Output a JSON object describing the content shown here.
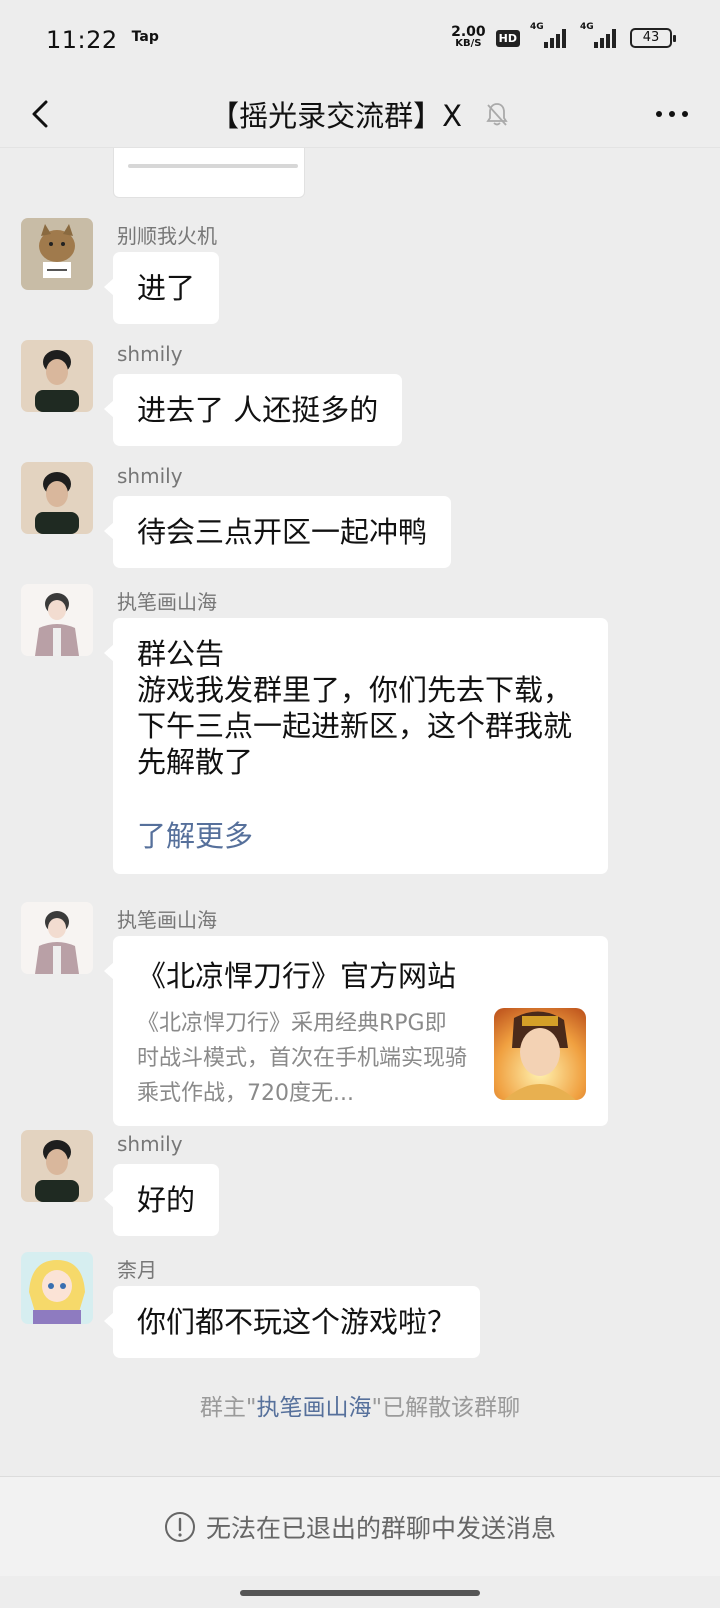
{
  "status_bar": {
    "time": "11:22",
    "app_tag": "Tap",
    "net_speed": "2.00",
    "net_unit": "KB/S",
    "hd_badge": "HD",
    "signal1_label": "4G",
    "signal2_label": "4G",
    "battery": "43"
  },
  "header": {
    "title": "【摇光录交流群】X",
    "back_icon": "chevron-left-icon",
    "mute_icon": "bell-muted-icon",
    "more_icon": "more-dots-icon"
  },
  "messages": [
    {
      "sender": "别顺我火机",
      "text": "进了",
      "avatar": "cat-photo"
    },
    {
      "sender": "shmily",
      "text": "进去了 人还挺多的",
      "avatar": "man-photo"
    },
    {
      "sender": "shmily",
      "text": "待会三点开区一起冲鸭",
      "avatar": "man-photo"
    },
    {
      "sender": "执笔画山海",
      "avatar": "illustrated-man",
      "notice_title": "群公告",
      "notice_body": "游戏我发群里了，你们先去下载，下午三点一起进新区，这个群我就先解散了",
      "notice_more": "了解更多"
    },
    {
      "sender": "执笔画山海",
      "avatar": "illustrated-man",
      "link_title": "《北凉悍刀行》官方网站",
      "link_desc": "《北凉悍刀行》采用经典RPG即时战斗模式，首次在手机端实现骑乘式作战，720度无..."
    },
    {
      "sender": "shmily",
      "text": "好的",
      "avatar": "man-photo"
    },
    {
      "sender": "柰月",
      "text": "你们都不玩这个游戏啦？",
      "avatar": "anime-girl"
    }
  ],
  "system_note": {
    "prefix": "群主\"",
    "owner": "执笔画山海",
    "suffix": "\"已解散该群聊"
  },
  "bottom_bar": {
    "text": "无法在已退出的群聊中发送消息",
    "icon": "exclamation-circle-icon"
  },
  "colors": {
    "background": "#ededed",
    "bubble": "#ffffff",
    "link_blue": "#56709b"
  }
}
